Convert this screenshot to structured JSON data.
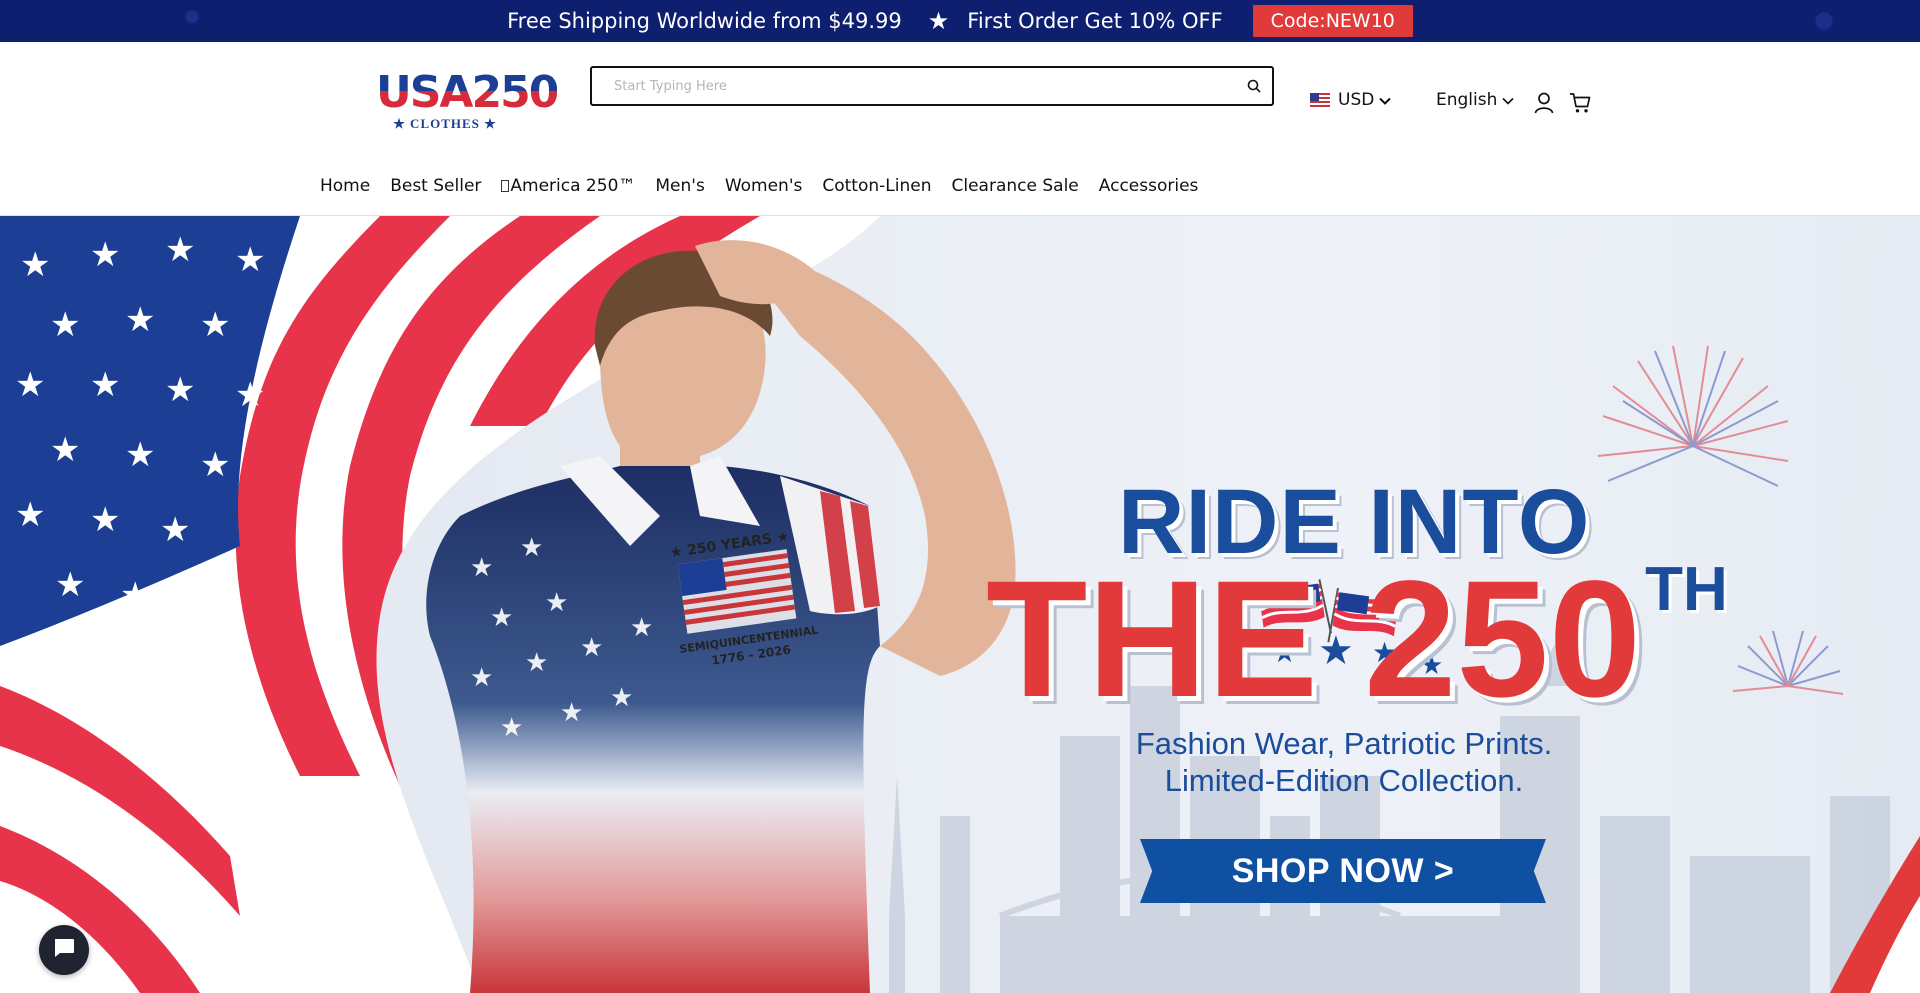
{
  "announcement": {
    "shipping_text": "Free Shipping Worldwide from $49.99",
    "separator": "★",
    "offer_text": "First Order Get 10% OFF",
    "code_label": "Code:NEW10"
  },
  "header": {
    "logo": {
      "main": "USA250",
      "sub": "★ CLOTHES ★"
    },
    "search": {
      "placeholder": "Start Typing Here",
      "value": ""
    },
    "currency": {
      "label": "USD"
    },
    "language": {
      "label": "English"
    }
  },
  "nav": {
    "items": [
      {
        "label": "Home"
      },
      {
        "label": "Best Seller"
      },
      {
        "label": "America 250™"
      },
      {
        "label": "Men's"
      },
      {
        "label": "Women's"
      },
      {
        "label": "Cotton-Linen"
      },
      {
        "label": "Clearance Sale"
      },
      {
        "label": "Accessories"
      }
    ]
  },
  "hero": {
    "headline_1": "RIDE INTO",
    "headline_2": "THE 250",
    "headline_sup": "TH",
    "subline_1": "Fashion Wear, Patriotic Prints.",
    "subline_2": "Limited-Edition Collection.",
    "cta_label": "SHOP NOW >",
    "shirt_print": {
      "top": "★ 250 YEARS ★",
      "word": "SEMIQUINCENTENNIAL",
      "years": "1776 - 2026"
    }
  },
  "colors": {
    "navy": "#0d1f6e",
    "brand_blue": "#1a4d9c",
    "brand_red": "#e23a3a",
    "cta_blue": "#1050a3"
  },
  "icons": [
    "search-icon",
    "us-flag-icon",
    "chevron-down-icon",
    "user-icon",
    "cart-icon",
    "chat-icon"
  ]
}
